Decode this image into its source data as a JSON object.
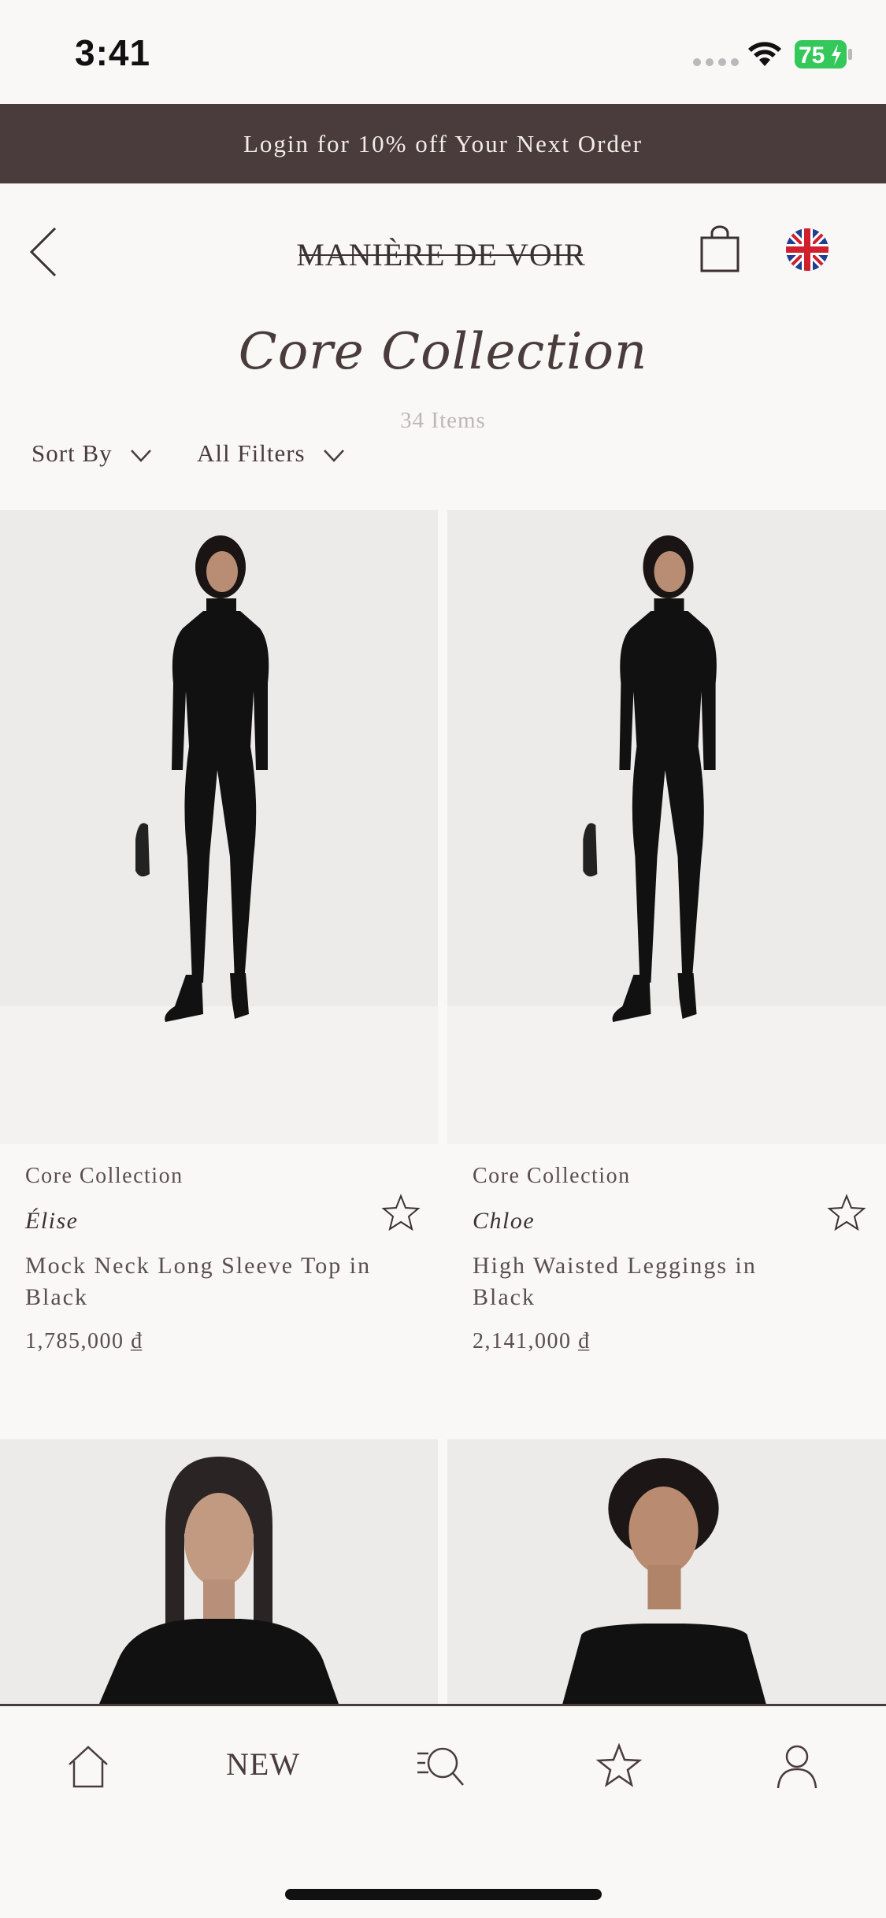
{
  "status_bar": {
    "time": "3:41",
    "battery": "75"
  },
  "promo_banner": {
    "text": "Login for 10% off Your Next Order"
  },
  "header": {
    "brand": "MANIÈRE DE VOIR"
  },
  "page": {
    "title": "Core Collection",
    "item_count": "34 Items"
  },
  "filters": {
    "sort_label": "Sort By",
    "filter_label": "All Filters"
  },
  "products": [
    {
      "collection": "Core Collection",
      "designer": "Élise",
      "name": "Mock Neck Long Sleeve Top in Black",
      "price": "1,785,000 ₫"
    },
    {
      "collection": "Core Collection",
      "designer": "Chloe",
      "name": "High Waisted Leggings in Black",
      "price": "2,141,000 ₫"
    }
  ],
  "bottom_nav": {
    "new_label": "NEW"
  },
  "colors": {
    "banner": "#4a3c3c",
    "background": "#f9f8f6",
    "text": "#3b3232",
    "flag_blue": "#1f3f8f",
    "flag_red": "#d0202e",
    "battery_green": "#34c759"
  }
}
